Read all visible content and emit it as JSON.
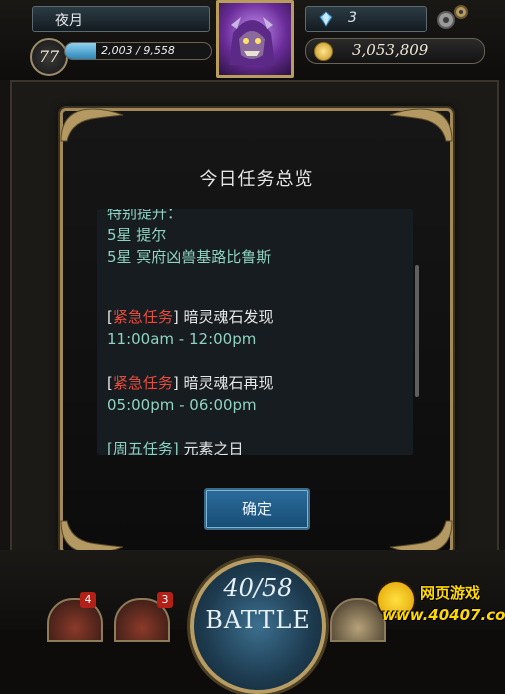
{
  "player": {
    "name": "夜月",
    "level": "77",
    "exp_text": "2,003 / 9,558",
    "exp_fraction": 0.21
  },
  "currency": {
    "gems": "3",
    "gold": "3,053,809"
  },
  "dialog": {
    "title": "今日任务总览",
    "lines": {
      "l0": "特别提升：",
      "l1": "5星 提尔",
      "l2": "5星 冥府凶兽基路比鲁斯",
      "b1_open": "[",
      "b1_tag": "紧急任务",
      "b1_close": "]",
      "b1_text": " 暗灵魂石发现",
      "b1_time": "11:00am - 12:00pm",
      "b2_open": "[",
      "b2_tag": "紧急任务",
      "b2_close": "]",
      "b2_text": " 暗灵魂石再现",
      "b2_time": "05:00pm - 06:00pm",
      "b3_open": "[",
      "b3_tag": "周五任务",
      "b3_close": "]",
      "b3_text": " 元素之日"
    },
    "confirm_label": "确定"
  },
  "bottom": {
    "badge1": "4",
    "badge2": "3",
    "battle_count": "40/58",
    "battle_label": "BATTLE"
  },
  "watermark": {
    "line1": "网页游戏",
    "line2": "www.40407.com"
  },
  "colors": {
    "accent_gold": "#a1895a",
    "text_teal": "#8fd3c3",
    "tag_red": "#e84c3d",
    "button_blue": "#2c6c9c"
  }
}
